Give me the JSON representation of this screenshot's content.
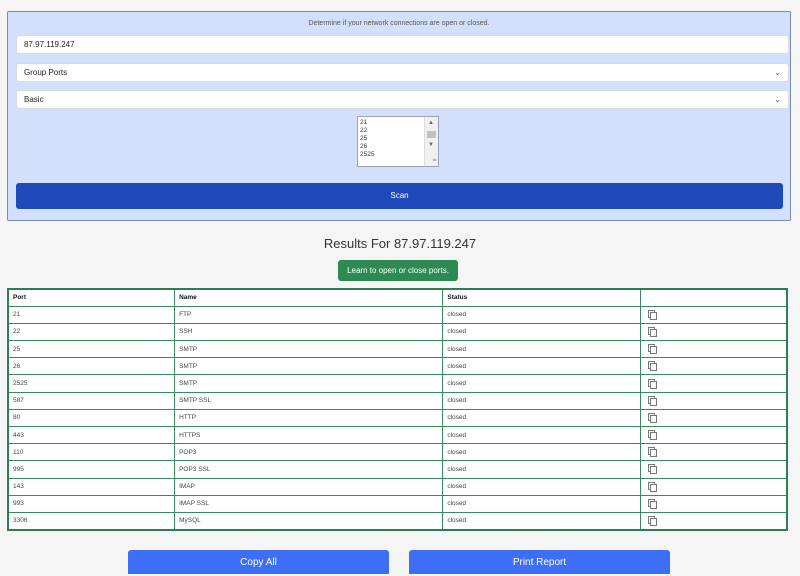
{
  "form": {
    "description": "Determine if your network connections are open or closed.",
    "ip_value": "87.97.119.247",
    "group_select": "Group Ports",
    "mode_select": "Basic",
    "port_list": [
      "21",
      "22",
      "25",
      "26",
      "2525"
    ],
    "scan_label": "Scan"
  },
  "results": {
    "title": "Results For 87.97.119.247",
    "learn_label": "Learn to open or close ports.",
    "headers": {
      "port": "Port",
      "name": "Name",
      "status": "Status"
    },
    "rows": [
      {
        "port": "21",
        "name": "FTP",
        "status": "closed"
      },
      {
        "port": "22",
        "name": "SSH",
        "status": "closed"
      },
      {
        "port": "25",
        "name": "SMTP",
        "status": "closed"
      },
      {
        "port": "26",
        "name": "SMTP",
        "status": "closed"
      },
      {
        "port": "2525",
        "name": "SMTP",
        "status": "closed"
      },
      {
        "port": "587",
        "name": "SMTP SSL",
        "status": "closed"
      },
      {
        "port": "80",
        "name": "HTTP",
        "status": "closed"
      },
      {
        "port": "443",
        "name": "HTTPS",
        "status": "closed"
      },
      {
        "port": "110",
        "name": "POP3",
        "status": "closed"
      },
      {
        "port": "995",
        "name": "POP3 SSL",
        "status": "closed"
      },
      {
        "port": "143",
        "name": "IMAP",
        "status": "closed"
      },
      {
        "port": "993",
        "name": "IMAP SSL",
        "status": "closed"
      },
      {
        "port": "3306",
        "name": "MySQL",
        "status": "closed"
      }
    ]
  },
  "actions": {
    "copy_all_label": "Copy All",
    "print_label": "Print Report"
  },
  "colors": {
    "panel_bg": "#d2e0fb",
    "scan_button": "#1f4ab7",
    "learn_button": "#2d8a53",
    "table_border": "#2e7d4f",
    "bottom_button": "#3d6ef5"
  }
}
